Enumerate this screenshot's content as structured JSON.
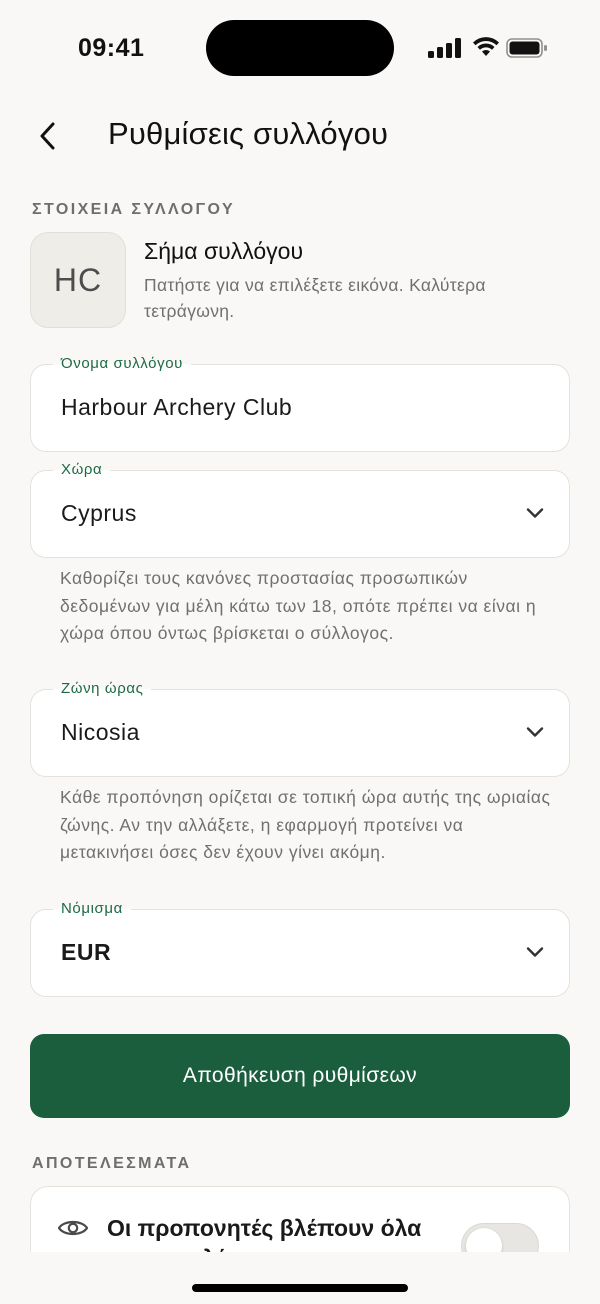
{
  "status_bar": {
    "time": "09:41"
  },
  "header": {
    "title": "Ρυθμίσεις συλλόγου"
  },
  "section_club": {
    "label": "ΣΤΟΙΧΕΙΑ ΣΥΛΛΟΓΟΥ"
  },
  "crest": {
    "initials": "HC",
    "title": "Σήμα συλλόγου",
    "hint": "Πατήστε για να επιλέξετε εικόνα. Καλύτερα τετράγωνη."
  },
  "fields": {
    "name": {
      "label": "Όνομα συλλόγου",
      "value": "Harbour Archery Club"
    },
    "country": {
      "label": "Χώρα",
      "value": "Cyprus",
      "help": "Καθορίζει τους κανόνες προστασίας προσωπικών δεδομένων για μέλη κάτω των 18, οπότε πρέπει να είναι η χώρα όπου όντως βρίσκεται ο σύλλογος."
    },
    "timezone": {
      "label": "Ζώνη ώρας",
      "value": "Nicosia",
      "help": "Κάθε προπόνηση ορίζεται σε τοπική ώρα αυτής της ωριαίας ζώνης. Αν την αλλάξετε, η εφαρμογή προτείνει να μετακινήσει όσες δεν έχουν γίνει ακόμη."
    },
    "currency": {
      "label": "Νόμισμα",
      "value": "EUR"
    }
  },
  "save_button": {
    "label": "Αποθήκευση ρυθμίσεων"
  },
  "section_results": {
    "label": "ΑΠΟΤΕΛΕΣΜΑΤΑ"
  },
  "results_card": {
    "title": "Οι προπονητές βλέπουν όλα τα αποτελέσματα",
    "toggle_on": false
  },
  "colors": {
    "accent": "#1b5e3e",
    "label_green": "#1d6a45",
    "background": "#faf8f6"
  },
  "icons": {
    "back": "chevron-left-icon",
    "dropdown": "chevron-down-icon",
    "visibility": "eye-icon"
  }
}
